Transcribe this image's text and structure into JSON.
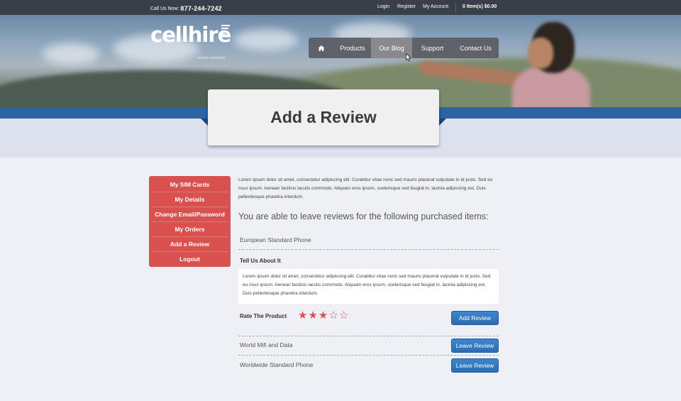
{
  "topbar": {
    "call_label": "Call Us Now:",
    "phone": "877-244-7242",
    "login": "Login",
    "register": "Register",
    "my_account": "My Account",
    "cart": "0 Item(s) $0.00"
  },
  "logo": {
    "name": "cellhire",
    "tagline": "mobile solutions"
  },
  "nav": {
    "products": "Products",
    "blog": "Our Blog",
    "support": "Support",
    "contact": "Contact Us"
  },
  "page_title": "Add a Review",
  "sidebar": {
    "items": [
      {
        "label": "My SIM Cards"
      },
      {
        "label": "My Details"
      },
      {
        "label": "Change Email/Password"
      },
      {
        "label": "My Orders"
      },
      {
        "label": "Add a Review"
      },
      {
        "label": "Logout"
      }
    ]
  },
  "main": {
    "intro": "Lorem ipsum dolor sit amet, consectetur adipiscing elit. Curabitur vitae nunc sed mauris placerat vulputate in id justo. Sed eu risus ipsum. Aenean facilisis iaculis commodo. Aliquam eros ipsum, scelerisque sed feugiat in, lacinia adipiscing est. Duis pellentesque pharetra interdum.",
    "subhead": "You are able to leave reviews for the following purchased items:",
    "item1": "European Standard Phone",
    "tell_label": "Tell Us About It",
    "review_text": "Lorem ipsum dolor sit amet, consectetur adipiscing elit. Curabitur vitae nunc sed mauris placerat vulputate in id justo. Sed eu risus ipsum. Aenean facilisis iaculis commodo. Aliquam eros ipsum, scelerisque sed feugiat in, lacinia adipiscing est. Duis pellentesque pharetra interdum.",
    "rate_label": "Rate The Product",
    "rating": 3,
    "rating_max": 5,
    "add_review": "Add Review",
    "item2": "World Mifi and Data",
    "item3": "Worldwide Standard Phone",
    "leave_review": "Leave Review"
  },
  "colors": {
    "accent_red": "#d9514f",
    "accent_blue": "#2b63a3",
    "button_blue": "#2f77c2"
  }
}
